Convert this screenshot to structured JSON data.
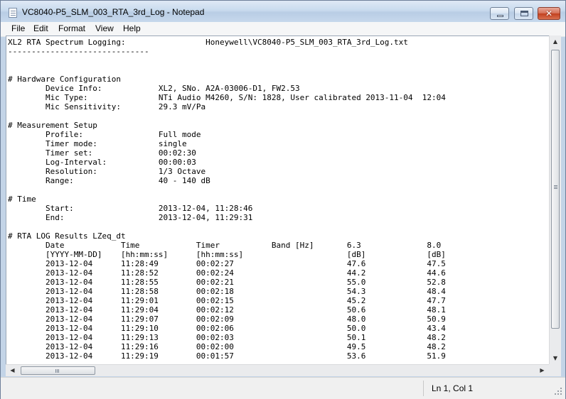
{
  "window": {
    "title": "VC8040-P5_SLM_003_RTA_3rd_Log - Notepad",
    "minimize_glyph": "",
    "close_glyph": "✕"
  },
  "menu": {
    "file": "File",
    "edit": "Edit",
    "format": "Format",
    "view": "View",
    "help": "Help"
  },
  "document": {
    "text": "XL2 RTA Spectrum Logging:                 Honeywell\\VC8040-P5_SLM_003_RTA_3rd_Log.txt\n------------------------------\n\n\n# Hardware Configuration\n        Device Info:            XL2, SNo. A2A-03006-D1, FW2.53\n        Mic Type:               NTi Audio M4260, S/N: 1828, User calibrated 2013-11-04  12:04\n        Mic Sensitivity:        29.3 mV/Pa\n\n# Measurement Setup\n        Profile:                Full mode\n        Timer mode:             single\n        Timer set:              00:02:30\n        Log-Interval:           00:00:03\n        Resolution:             1/3 Octave\n        Range:                  40 - 140 dB\n\n# Time\n        Start:                  2013-12-04, 11:28:46\n        End:                    2013-12-04, 11:29:31\n\n# RTA LOG Results LZeq_dt\n        Date            Time            Timer           Band [Hz]       6.3              8.0\n        [YYYY-MM-DD]    [hh:mm:ss]      [hh:mm:ss]                      [dB]             [dB]\n        2013-12-04      11:28:49        00:02:27                        47.6             47.5\n        2013-12-04      11:28:52        00:02:24                        44.2             44.6\n        2013-12-04      11:28:55        00:02:21                        55.0             52.8\n        2013-12-04      11:28:58        00:02:18                        54.3             48.4\n        2013-12-04      11:29:01        00:02:15                        45.2             47.7\n        2013-12-04      11:29:04        00:02:12                        50.6             48.1\n        2013-12-04      11:29:07        00:02:09                        48.0             50.9\n        2013-12-04      11:29:10        00:02:06                        50.0             43.4\n        2013-12-04      11:29:13        00:02:03                        50.1             48.2\n        2013-12-04      11:29:16        00:02:00                        49.5             48.2\n        2013-12-04      11:29:19        00:01:57                        53.6             51.9"
  },
  "scrollbars": {
    "up_arrow": "▲",
    "down_arrow": "▼",
    "left_arrow": "◀",
    "right_arrow": "▶"
  },
  "statusbar": {
    "position": "Ln 1, Col 1"
  }
}
